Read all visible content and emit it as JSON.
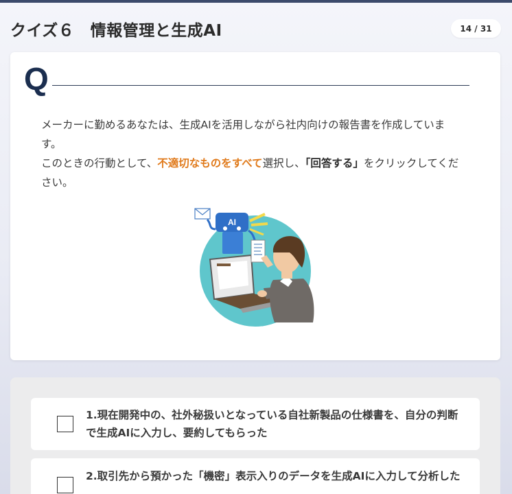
{
  "header": {
    "title": "クイズ６　情報管理と生成AI",
    "counter": "14 / 31"
  },
  "question": {
    "mark": "Q",
    "line1": "メーカーに勤めるあなたは、生成AIを活用しながら社内向けの報告書を作成しています。",
    "line2_pre": "このときの行動として、",
    "line2_emphasis": "不適切なものをすべて",
    "line2_mid": "選択し、",
    "line2_button_ref": "「回答する」",
    "line2_post": "をクリックしてください。",
    "illustration": {
      "icons": [
        "ai-robot-icon",
        "mail-icon",
        "businessman-icon",
        "laptop-icon",
        "document-icon"
      ],
      "robot_label": "AI"
    }
  },
  "answers": [
    {
      "label": "1.現在開発中の、社外秘扱いとなっている自社新製品の仕様書を、自分の判断で生成AIに入力し、要約してもらった",
      "checked": false
    },
    {
      "label": "2.取引先から預かった「機密」表示入りのデータを生成AIに入力して分析した",
      "checked": false
    }
  ],
  "colors": {
    "accent_orange": "#e07a1b",
    "navy": "#1b2e4f",
    "top_bar": "#3c4a6b",
    "illustration_teal": "#5fc6cc",
    "robot_blue": "#2f6fc7"
  }
}
